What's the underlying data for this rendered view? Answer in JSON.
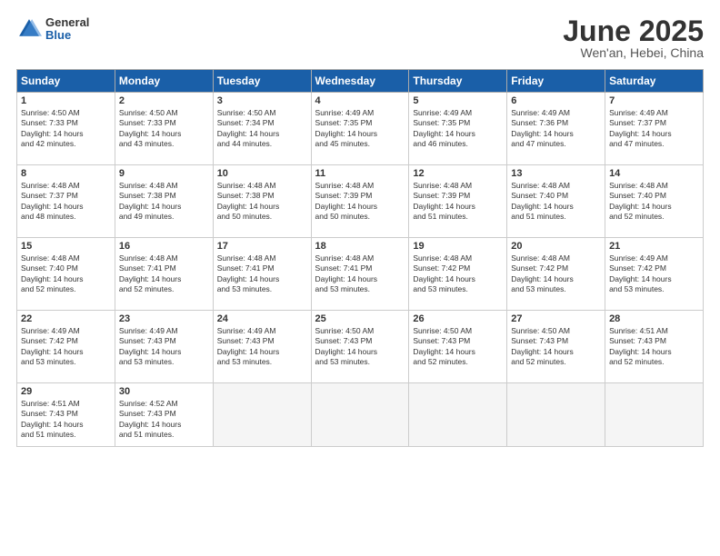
{
  "logo": {
    "general": "General",
    "blue": "Blue"
  },
  "header": {
    "month": "June 2025",
    "location": "Wen'an, Hebei, China"
  },
  "weekdays": [
    "Sunday",
    "Monday",
    "Tuesday",
    "Wednesday",
    "Thursday",
    "Friday",
    "Saturday"
  ],
  "weeks": [
    [
      {
        "day": "1",
        "info": "Sunrise: 4:50 AM\nSunset: 7:33 PM\nDaylight: 14 hours\nand 42 minutes."
      },
      {
        "day": "2",
        "info": "Sunrise: 4:50 AM\nSunset: 7:33 PM\nDaylight: 14 hours\nand 43 minutes."
      },
      {
        "day": "3",
        "info": "Sunrise: 4:50 AM\nSunset: 7:34 PM\nDaylight: 14 hours\nand 44 minutes."
      },
      {
        "day": "4",
        "info": "Sunrise: 4:49 AM\nSunset: 7:35 PM\nDaylight: 14 hours\nand 45 minutes."
      },
      {
        "day": "5",
        "info": "Sunrise: 4:49 AM\nSunset: 7:35 PM\nDaylight: 14 hours\nand 46 minutes."
      },
      {
        "day": "6",
        "info": "Sunrise: 4:49 AM\nSunset: 7:36 PM\nDaylight: 14 hours\nand 47 minutes."
      },
      {
        "day": "7",
        "info": "Sunrise: 4:49 AM\nSunset: 7:37 PM\nDaylight: 14 hours\nand 47 minutes."
      }
    ],
    [
      {
        "day": "8",
        "info": "Sunrise: 4:48 AM\nSunset: 7:37 PM\nDaylight: 14 hours\nand 48 minutes."
      },
      {
        "day": "9",
        "info": "Sunrise: 4:48 AM\nSunset: 7:38 PM\nDaylight: 14 hours\nand 49 minutes."
      },
      {
        "day": "10",
        "info": "Sunrise: 4:48 AM\nSunset: 7:38 PM\nDaylight: 14 hours\nand 50 minutes."
      },
      {
        "day": "11",
        "info": "Sunrise: 4:48 AM\nSunset: 7:39 PM\nDaylight: 14 hours\nand 50 minutes."
      },
      {
        "day": "12",
        "info": "Sunrise: 4:48 AM\nSunset: 7:39 PM\nDaylight: 14 hours\nand 51 minutes."
      },
      {
        "day": "13",
        "info": "Sunrise: 4:48 AM\nSunset: 7:40 PM\nDaylight: 14 hours\nand 51 minutes."
      },
      {
        "day": "14",
        "info": "Sunrise: 4:48 AM\nSunset: 7:40 PM\nDaylight: 14 hours\nand 52 minutes."
      }
    ],
    [
      {
        "day": "15",
        "info": "Sunrise: 4:48 AM\nSunset: 7:40 PM\nDaylight: 14 hours\nand 52 minutes."
      },
      {
        "day": "16",
        "info": "Sunrise: 4:48 AM\nSunset: 7:41 PM\nDaylight: 14 hours\nand 52 minutes."
      },
      {
        "day": "17",
        "info": "Sunrise: 4:48 AM\nSunset: 7:41 PM\nDaylight: 14 hours\nand 53 minutes."
      },
      {
        "day": "18",
        "info": "Sunrise: 4:48 AM\nSunset: 7:41 PM\nDaylight: 14 hours\nand 53 minutes."
      },
      {
        "day": "19",
        "info": "Sunrise: 4:48 AM\nSunset: 7:42 PM\nDaylight: 14 hours\nand 53 minutes."
      },
      {
        "day": "20",
        "info": "Sunrise: 4:48 AM\nSunset: 7:42 PM\nDaylight: 14 hours\nand 53 minutes."
      },
      {
        "day": "21",
        "info": "Sunrise: 4:49 AM\nSunset: 7:42 PM\nDaylight: 14 hours\nand 53 minutes."
      }
    ],
    [
      {
        "day": "22",
        "info": "Sunrise: 4:49 AM\nSunset: 7:42 PM\nDaylight: 14 hours\nand 53 minutes."
      },
      {
        "day": "23",
        "info": "Sunrise: 4:49 AM\nSunset: 7:43 PM\nDaylight: 14 hours\nand 53 minutes."
      },
      {
        "day": "24",
        "info": "Sunrise: 4:49 AM\nSunset: 7:43 PM\nDaylight: 14 hours\nand 53 minutes."
      },
      {
        "day": "25",
        "info": "Sunrise: 4:50 AM\nSunset: 7:43 PM\nDaylight: 14 hours\nand 53 minutes."
      },
      {
        "day": "26",
        "info": "Sunrise: 4:50 AM\nSunset: 7:43 PM\nDaylight: 14 hours\nand 52 minutes."
      },
      {
        "day": "27",
        "info": "Sunrise: 4:50 AM\nSunset: 7:43 PM\nDaylight: 14 hours\nand 52 minutes."
      },
      {
        "day": "28",
        "info": "Sunrise: 4:51 AM\nSunset: 7:43 PM\nDaylight: 14 hours\nand 52 minutes."
      }
    ],
    [
      {
        "day": "29",
        "info": "Sunrise: 4:51 AM\nSunset: 7:43 PM\nDaylight: 14 hours\nand 51 minutes."
      },
      {
        "day": "30",
        "info": "Sunrise: 4:52 AM\nSunset: 7:43 PM\nDaylight: 14 hours\nand 51 minutes."
      },
      {
        "day": "",
        "info": ""
      },
      {
        "day": "",
        "info": ""
      },
      {
        "day": "",
        "info": ""
      },
      {
        "day": "",
        "info": ""
      },
      {
        "day": "",
        "info": ""
      }
    ]
  ]
}
